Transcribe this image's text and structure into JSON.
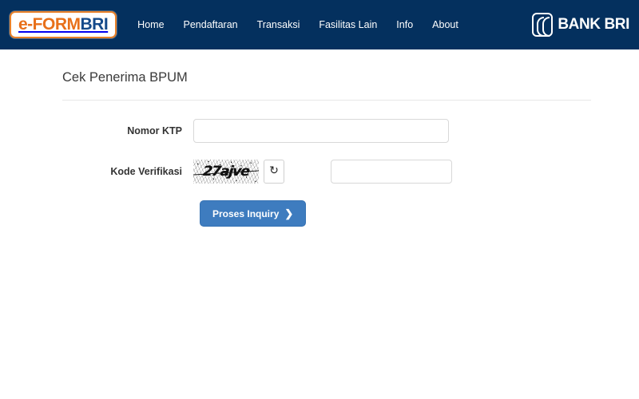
{
  "header": {
    "logo": {
      "text_primary": "e-FORM",
      "text_secondary": "BRI",
      "accent_color": "#e8701a",
      "secondary_color": "#154a8a"
    },
    "nav_items": [
      {
        "label": "Home"
      },
      {
        "label": "Pendaftaran"
      },
      {
        "label": "Transaksi"
      },
      {
        "label": "Fasilitas Lain"
      },
      {
        "label": "Info"
      },
      {
        "label": "About"
      }
    ],
    "bank_logo": {
      "icon": "bank-bri-mark-icon",
      "label": "BANK BRI"
    },
    "background_color": "#04305e"
  },
  "main": {
    "page_title": "Cek Penerima BPUM",
    "form": {
      "ktp": {
        "label": "Nomor KTP",
        "value": "",
        "placeholder": ""
      },
      "captcha": {
        "label": "Kode Verifikasi",
        "image_text": "27ajve",
        "refresh_icon": "↻",
        "input_value": "",
        "input_placeholder": ""
      },
      "submit": {
        "label": "Proses Inquiry",
        "chevron": "❯",
        "color": "#3e7cbf"
      }
    }
  }
}
